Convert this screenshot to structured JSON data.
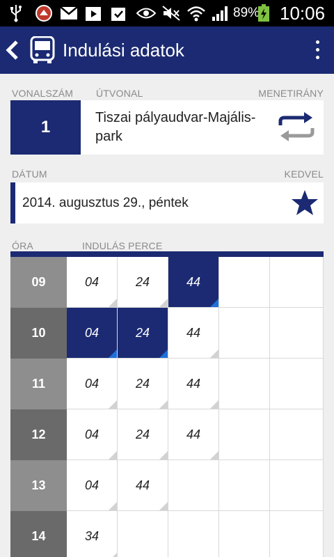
{
  "status_bar": {
    "battery_percent": "89%",
    "time": "10:06",
    "icons": [
      "usb-icon",
      "app-notification-icon",
      "gmail-icon",
      "play-store-icon",
      "task-icon",
      "eye-icon",
      "mute-icon",
      "wifi-icon",
      "signal-icon",
      "battery-icon"
    ]
  },
  "action_bar": {
    "title": "Indulási adatok",
    "back_icon": "back-chevron-icon",
    "app_icon": "bus-icon",
    "menu_icon": "overflow-menu-icon"
  },
  "labels": {
    "line_number": "VONALSZÁM",
    "route": "ÚTVONAL",
    "direction": "MENETIRÁNY",
    "date": "DÁTUM",
    "favorite": "KEDVEL",
    "hour": "ÓRA",
    "departure_minute": "INDULÁS PERCE"
  },
  "route": {
    "number": "1",
    "name": "Tiszai pályaudvar-Majális-park",
    "swap_icon": "swap-direction-icon"
  },
  "date": {
    "value": "2014. augusztus 29., péntek",
    "favorite_icon": "star-icon"
  },
  "colors": {
    "primary": "#1b2a72",
    "accent_corner": "#1f6fd8",
    "hour_light": "#8e8e8e",
    "hour_dark": "#6a6a6a"
  },
  "timetable": [
    {
      "hour": "09",
      "minutes": [
        "04",
        "24",
        "44",
        "",
        ""
      ],
      "highlighted": [
        false,
        false,
        true,
        false,
        false
      ]
    },
    {
      "hour": "10",
      "minutes": [
        "04",
        "24",
        "44",
        "",
        ""
      ],
      "highlighted": [
        true,
        true,
        false,
        false,
        false
      ]
    },
    {
      "hour": "11",
      "minutes": [
        "04",
        "24",
        "44",
        "",
        ""
      ],
      "highlighted": [
        false,
        false,
        false,
        false,
        false
      ]
    },
    {
      "hour": "12",
      "minutes": [
        "04",
        "24",
        "44",
        "",
        ""
      ],
      "highlighted": [
        false,
        false,
        false,
        false,
        false
      ]
    },
    {
      "hour": "13",
      "minutes": [
        "04",
        "44",
        "",
        "",
        ""
      ],
      "highlighted": [
        false,
        false,
        false,
        false,
        false
      ]
    },
    {
      "hour": "14",
      "minutes": [
        "34",
        "",
        "",
        "",
        ""
      ],
      "highlighted": [
        false,
        false,
        false,
        false,
        false
      ]
    }
  ]
}
